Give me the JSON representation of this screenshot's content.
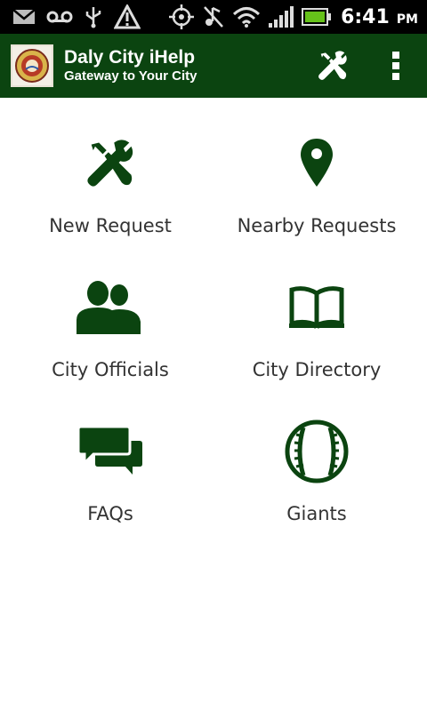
{
  "status_bar": {
    "time": "6:41",
    "ampm": "PM",
    "left_icons": [
      "gmail-icon",
      "voicemail-icon",
      "usb-icon",
      "warning-icon"
    ],
    "right_icons": [
      "gps-icon",
      "mute-icon",
      "wifi-icon",
      "signal-icon",
      "battery-icon"
    ]
  },
  "action_bar": {
    "title": "Daly City iHelp",
    "subtitle": "Gateway to Your City",
    "logo_text": "DALY CITY",
    "brand_color": "#0b4410"
  },
  "tiles": [
    {
      "label": "New Request",
      "icon": "tools-icon"
    },
    {
      "label": "Nearby Requests",
      "icon": "map-pin-icon"
    },
    {
      "label": "City Officials",
      "icon": "people-icon"
    },
    {
      "label": "City Directory",
      "icon": "book-icon"
    },
    {
      "label": "FAQs",
      "icon": "chat-bubbles-icon"
    },
    {
      "label": "Giants",
      "icon": "baseball-icon"
    }
  ],
  "icon_color": "#0b4410"
}
